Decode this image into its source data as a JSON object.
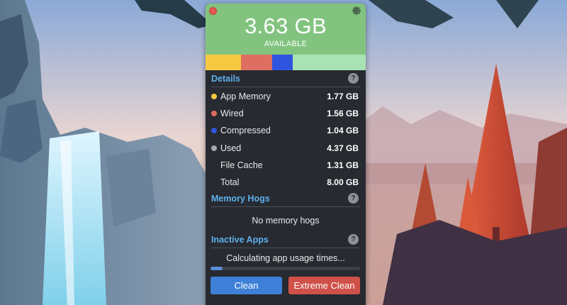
{
  "colors": {
    "header_bg": "#82c47f",
    "app_memory": "#f7c942",
    "wired": "#df6e62",
    "compressed": "#2f55e0",
    "used": "#a5a7ab",
    "free": "#a9e2b3",
    "accent": "#5eb0ec"
  },
  "header": {
    "available_value": "3.63 GB",
    "available_label": "AVAILABLE",
    "close_icon": "close-icon",
    "settings_icon": "gear-icon"
  },
  "usage_bar": [
    {
      "name": "App Memory",
      "fraction": 0.221,
      "color": "#f7c942"
    },
    {
      "name": "Wired",
      "fraction": 0.195,
      "color": "#df6e62"
    },
    {
      "name": "Compressed",
      "fraction": 0.13,
      "color": "#2f55e0"
    },
    {
      "name": "Free",
      "fraction": 0.454,
      "color": "#a9e2b3"
    }
  ],
  "details": {
    "title": "Details",
    "help": "?",
    "rows": [
      {
        "label": "App Memory",
        "value": "1.77 GB",
        "color": "#f7c942"
      },
      {
        "label": "Wired",
        "value": "1.56 GB",
        "color": "#df6e62"
      },
      {
        "label": "Compressed",
        "value": "1.04 GB",
        "color": "#2f55e0"
      },
      {
        "label": "Used",
        "value": "4.37 GB",
        "color": "#a5a7ab"
      },
      {
        "label": "File Cache",
        "value": "1.31 GB",
        "color": ""
      },
      {
        "label": "Total",
        "value": "8.00 GB",
        "color": ""
      }
    ]
  },
  "memory_hogs": {
    "title": "Memory Hogs",
    "help": "?",
    "empty_text": "No memory hogs"
  },
  "inactive_apps": {
    "title": "Inactive Apps",
    "help": "?",
    "status_text": "Calculating app usage times...",
    "progress": 0.08
  },
  "buttons": {
    "clean": "Clean",
    "extreme_clean": "Extreme Clean"
  }
}
